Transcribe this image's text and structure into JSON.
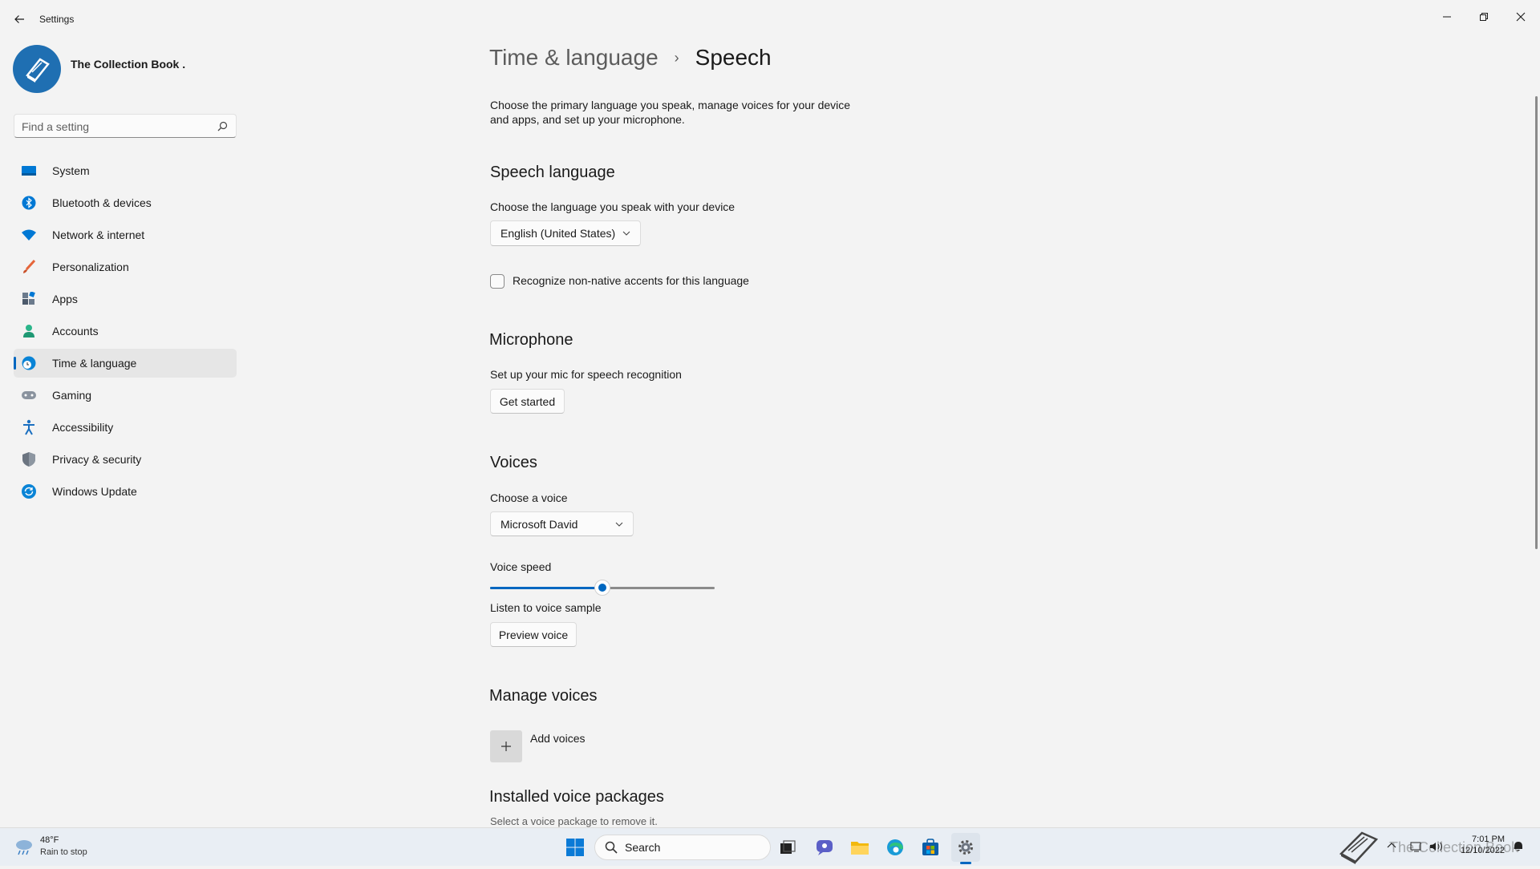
{
  "window": {
    "title": "Settings",
    "minimize_label": "",
    "icons": {
      "back": "back-arrow-icon",
      "minimize": "minimize-icon",
      "restore": "restore-icon",
      "close": "close-icon"
    }
  },
  "profile": {
    "name": "The Collection Book ."
  },
  "search": {
    "placeholder": "Find a setting",
    "value": ""
  },
  "nav": {
    "items": [
      {
        "label": "System",
        "icon": "system-icon",
        "color": "#0078d4"
      },
      {
        "label": "Bluetooth & devices",
        "icon": "bluetooth-icon",
        "color": "#0078d4"
      },
      {
        "label": "Network & internet",
        "icon": "wifi-icon",
        "color": "#0078d4"
      },
      {
        "label": "Personalization",
        "icon": "brush-icon",
        "color": "#e5653a"
      },
      {
        "label": "Apps",
        "icon": "apps-icon",
        "color": "#4c5a6b"
      },
      {
        "label": "Accounts",
        "icon": "account-icon",
        "color": "#2bb58a"
      },
      {
        "label": "Time & language",
        "icon": "globe-clock-icon",
        "color": "#0a84d6"
      },
      {
        "label": "Gaming",
        "icon": "gamepad-icon",
        "color": "#6b7480"
      },
      {
        "label": "Accessibility",
        "icon": "accessibility-icon",
        "color": "#1a6fc0"
      },
      {
        "label": "Privacy & security",
        "icon": "shield-icon",
        "color": "#6b7480"
      },
      {
        "label": "Windows Update",
        "icon": "update-icon",
        "color": "#0a84d6"
      }
    ],
    "selected": "Time & language"
  },
  "page": {
    "breadcrumb_parent": "Time & language",
    "breadcrumb_separator": "›",
    "title": "Speech",
    "intro": "Choose the primary language you speak, manage voices for your device and apps, and set up your microphone."
  },
  "speech_language": {
    "heading": "Speech language",
    "label": "Choose the language you speak with your device",
    "selected": "English (United States)",
    "accent_checkbox_label": "Recognize non-native accents for this language",
    "accent_checked": false
  },
  "microphone": {
    "heading": "Microphone",
    "label": "Set up your mic for speech recognition",
    "button": "Get started"
  },
  "voices": {
    "heading": "Voices",
    "choose_label": "Choose a voice",
    "selected": "Microsoft David",
    "speed_label": "Voice speed",
    "speed_fraction": 0.5,
    "sample_label": "Listen to voice sample",
    "preview_button": "Preview voice"
  },
  "manage_voices": {
    "heading": "Manage voices",
    "add_label": "Add voices"
  },
  "installed": {
    "heading": "Installed voice packages",
    "label": "Select a voice package to remove it."
  },
  "taskbar": {
    "weather_temp": "48°F",
    "weather_desc": "Rain to stop",
    "search_label": "Search",
    "time": "7:01 PM",
    "date": "12/10/2022",
    "watermark": "The Collection Book",
    "accent": "#0067c0"
  }
}
